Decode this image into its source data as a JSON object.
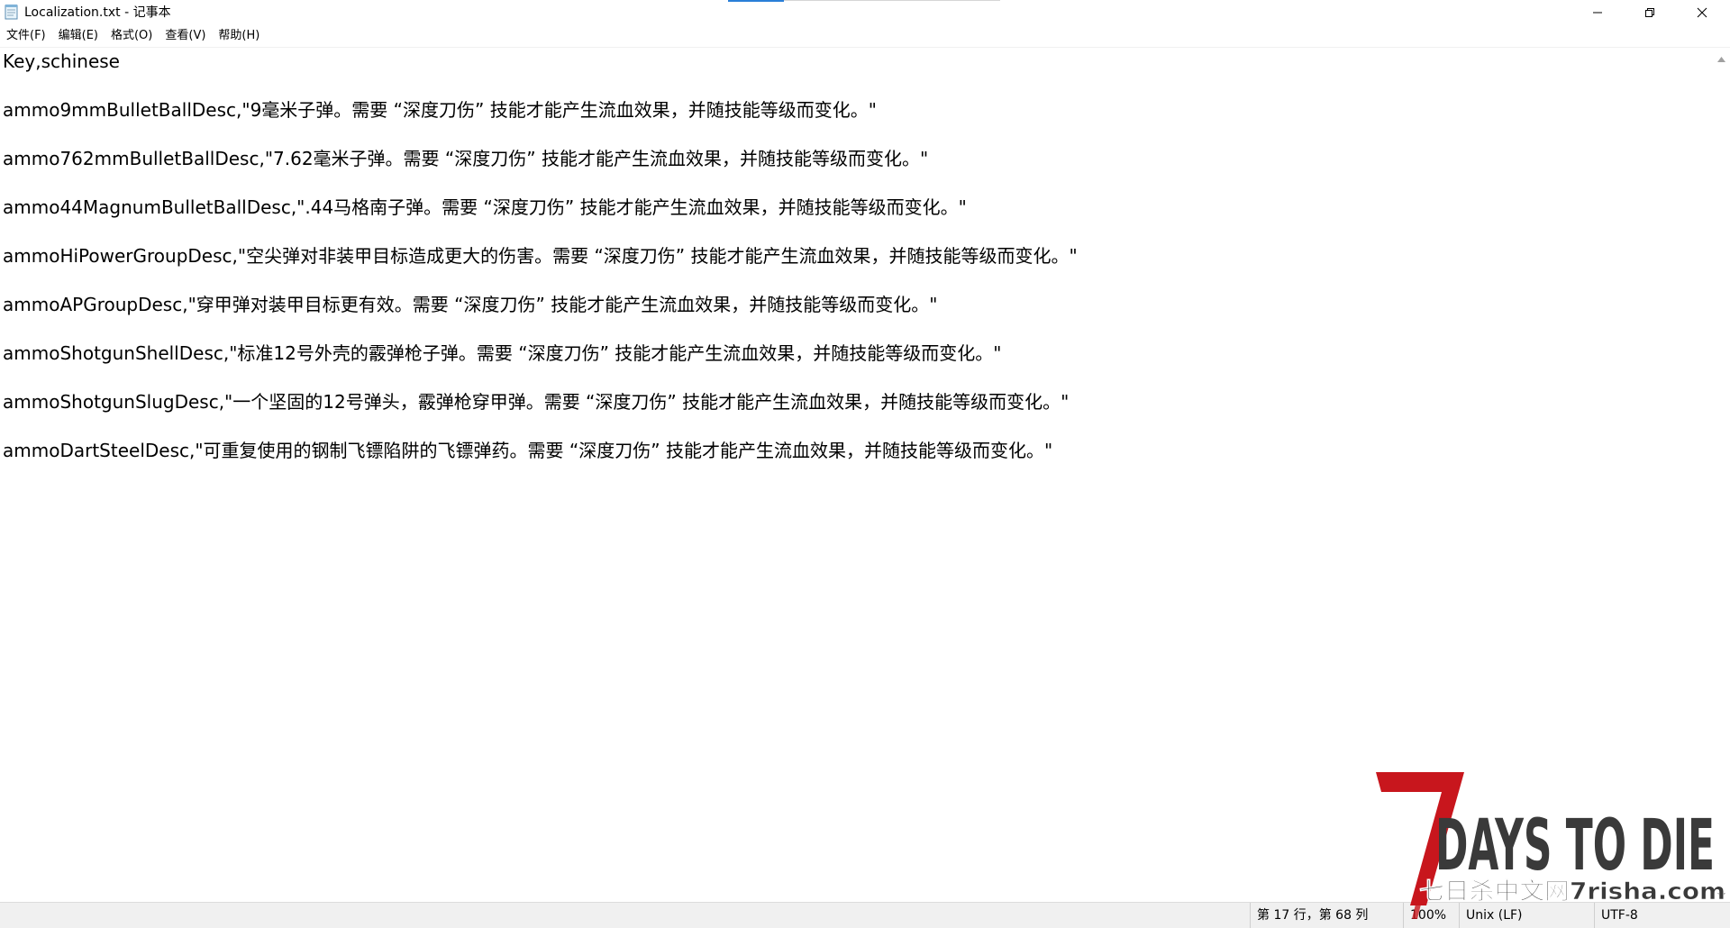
{
  "window": {
    "title": "Localization.txt - 记事本"
  },
  "controls": {
    "minimize_icon": "minimize-icon",
    "restore_icon": "restore-icon",
    "close_icon": "close-icon"
  },
  "menu": {
    "items": [
      {
        "label": "文件(F)"
      },
      {
        "label": "编辑(E)"
      },
      {
        "label": "格式(O)"
      },
      {
        "label": "查看(V)"
      },
      {
        "label": "帮助(H)"
      }
    ]
  },
  "editor": {
    "lines": [
      "Key,schinese",
      "",
      "ammo9mmBulletBallDesc,\"9毫米子弹。需要 “深度刀伤” 技能才能产生流血效果，并随技能等级而变化。\"",
      "",
      "ammo762mmBulletBallDesc,\"7.62毫米子弹。需要 “深度刀伤” 技能才能产生流血效果，并随技能等级而变化。\"",
      "",
      "ammo44MagnumBulletBallDesc,\".44马格南子弹。需要 “深度刀伤” 技能才能产生流血效果，并随技能等级而变化。\"",
      "",
      "ammoHiPowerGroupDesc,\"空尖弹对非装甲目标造成更大的伤害。需要 “深度刀伤” 技能才能产生流血效果，并随技能等级而变化。\"",
      "",
      "ammoAPGroupDesc,\"穿甲弹对装甲目标更有效。需要 “深度刀伤” 技能才能产生流血效果，并随技能等级而变化。\"",
      "",
      "ammoShotgunShellDesc,\"标准12号外壳的霰弹枪子弹。需要 “深度刀伤” 技能才能产生流血效果，并随技能等级而变化。\"",
      "",
      "ammoShotgunSlugDesc,\"一个坚固的12号弹头，霰弹枪穿甲弹。需要 “深度刀伤” 技能才能产生流血效果，并随技能等级而变化。\"",
      "",
      "ammoDartSteelDesc,\"可重复使用的钢制飞镖陷阱的飞镖弹药。需要 “深度刀伤” 技能才能产生流血效果，并随技能等级而变化。\""
    ]
  },
  "statusbar": {
    "position": "第 17 行，第 68 列",
    "zoom": "100%",
    "line_ending": "Unix (LF)",
    "encoding": "UTF-8"
  },
  "watermark": {
    "logo_text": "7DAYS TO DIE",
    "site_text": "七日杀中文网7risha.com"
  },
  "colors": {
    "accent": "#2a7fd8",
    "statusbar_bg": "#f0f0f0",
    "logo_red": "#c8161d",
    "logo_dark": "#3a3a3a"
  }
}
